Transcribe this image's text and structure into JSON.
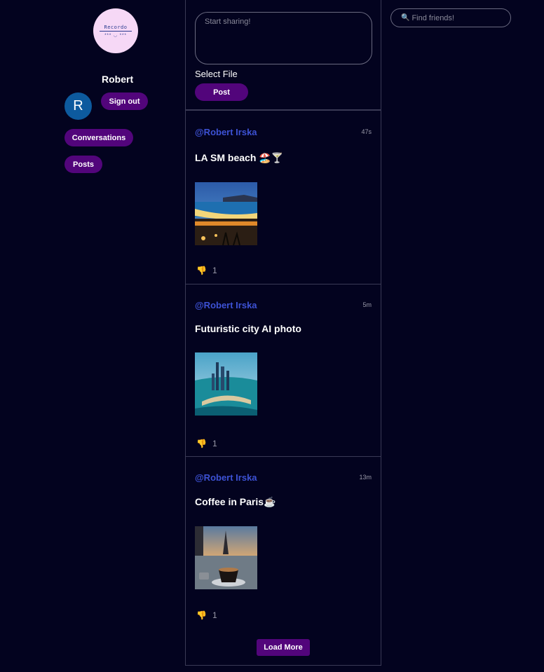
{
  "sidebar": {
    "logo_text": "Recordo",
    "logo_mark": "*** ◡ ***",
    "username": "Robert",
    "avatar_initial": "R",
    "signout_label": "Sign out",
    "conversations_label": "Conversations",
    "posts_label": "Posts"
  },
  "composer": {
    "placeholder": "Start sharing!",
    "select_file_label": "Select File",
    "post_label": "Post"
  },
  "posts": [
    {
      "author": "@Robert Irska",
      "time": "47s",
      "title": "LA SM beach 🏖️🍸",
      "image_icon": "beach-night-photo",
      "likes": "1"
    },
    {
      "author": "@Robert Irska",
      "time": "5m",
      "title": "Futuristic city AI photo",
      "image_icon": "futuristic-city-photo",
      "likes": "1"
    },
    {
      "author": "@Robert Irska",
      "time": "13m",
      "title": "Coffee in Paris☕",
      "image_icon": "paris-coffee-photo",
      "likes": "1"
    }
  ],
  "load_more_label": "Load More",
  "search": {
    "placeholder": "Find friends!"
  },
  "colors": {
    "background": "#03031f",
    "accent": "#52057b",
    "link": "#3d52d5",
    "border": "#3a3a55"
  }
}
